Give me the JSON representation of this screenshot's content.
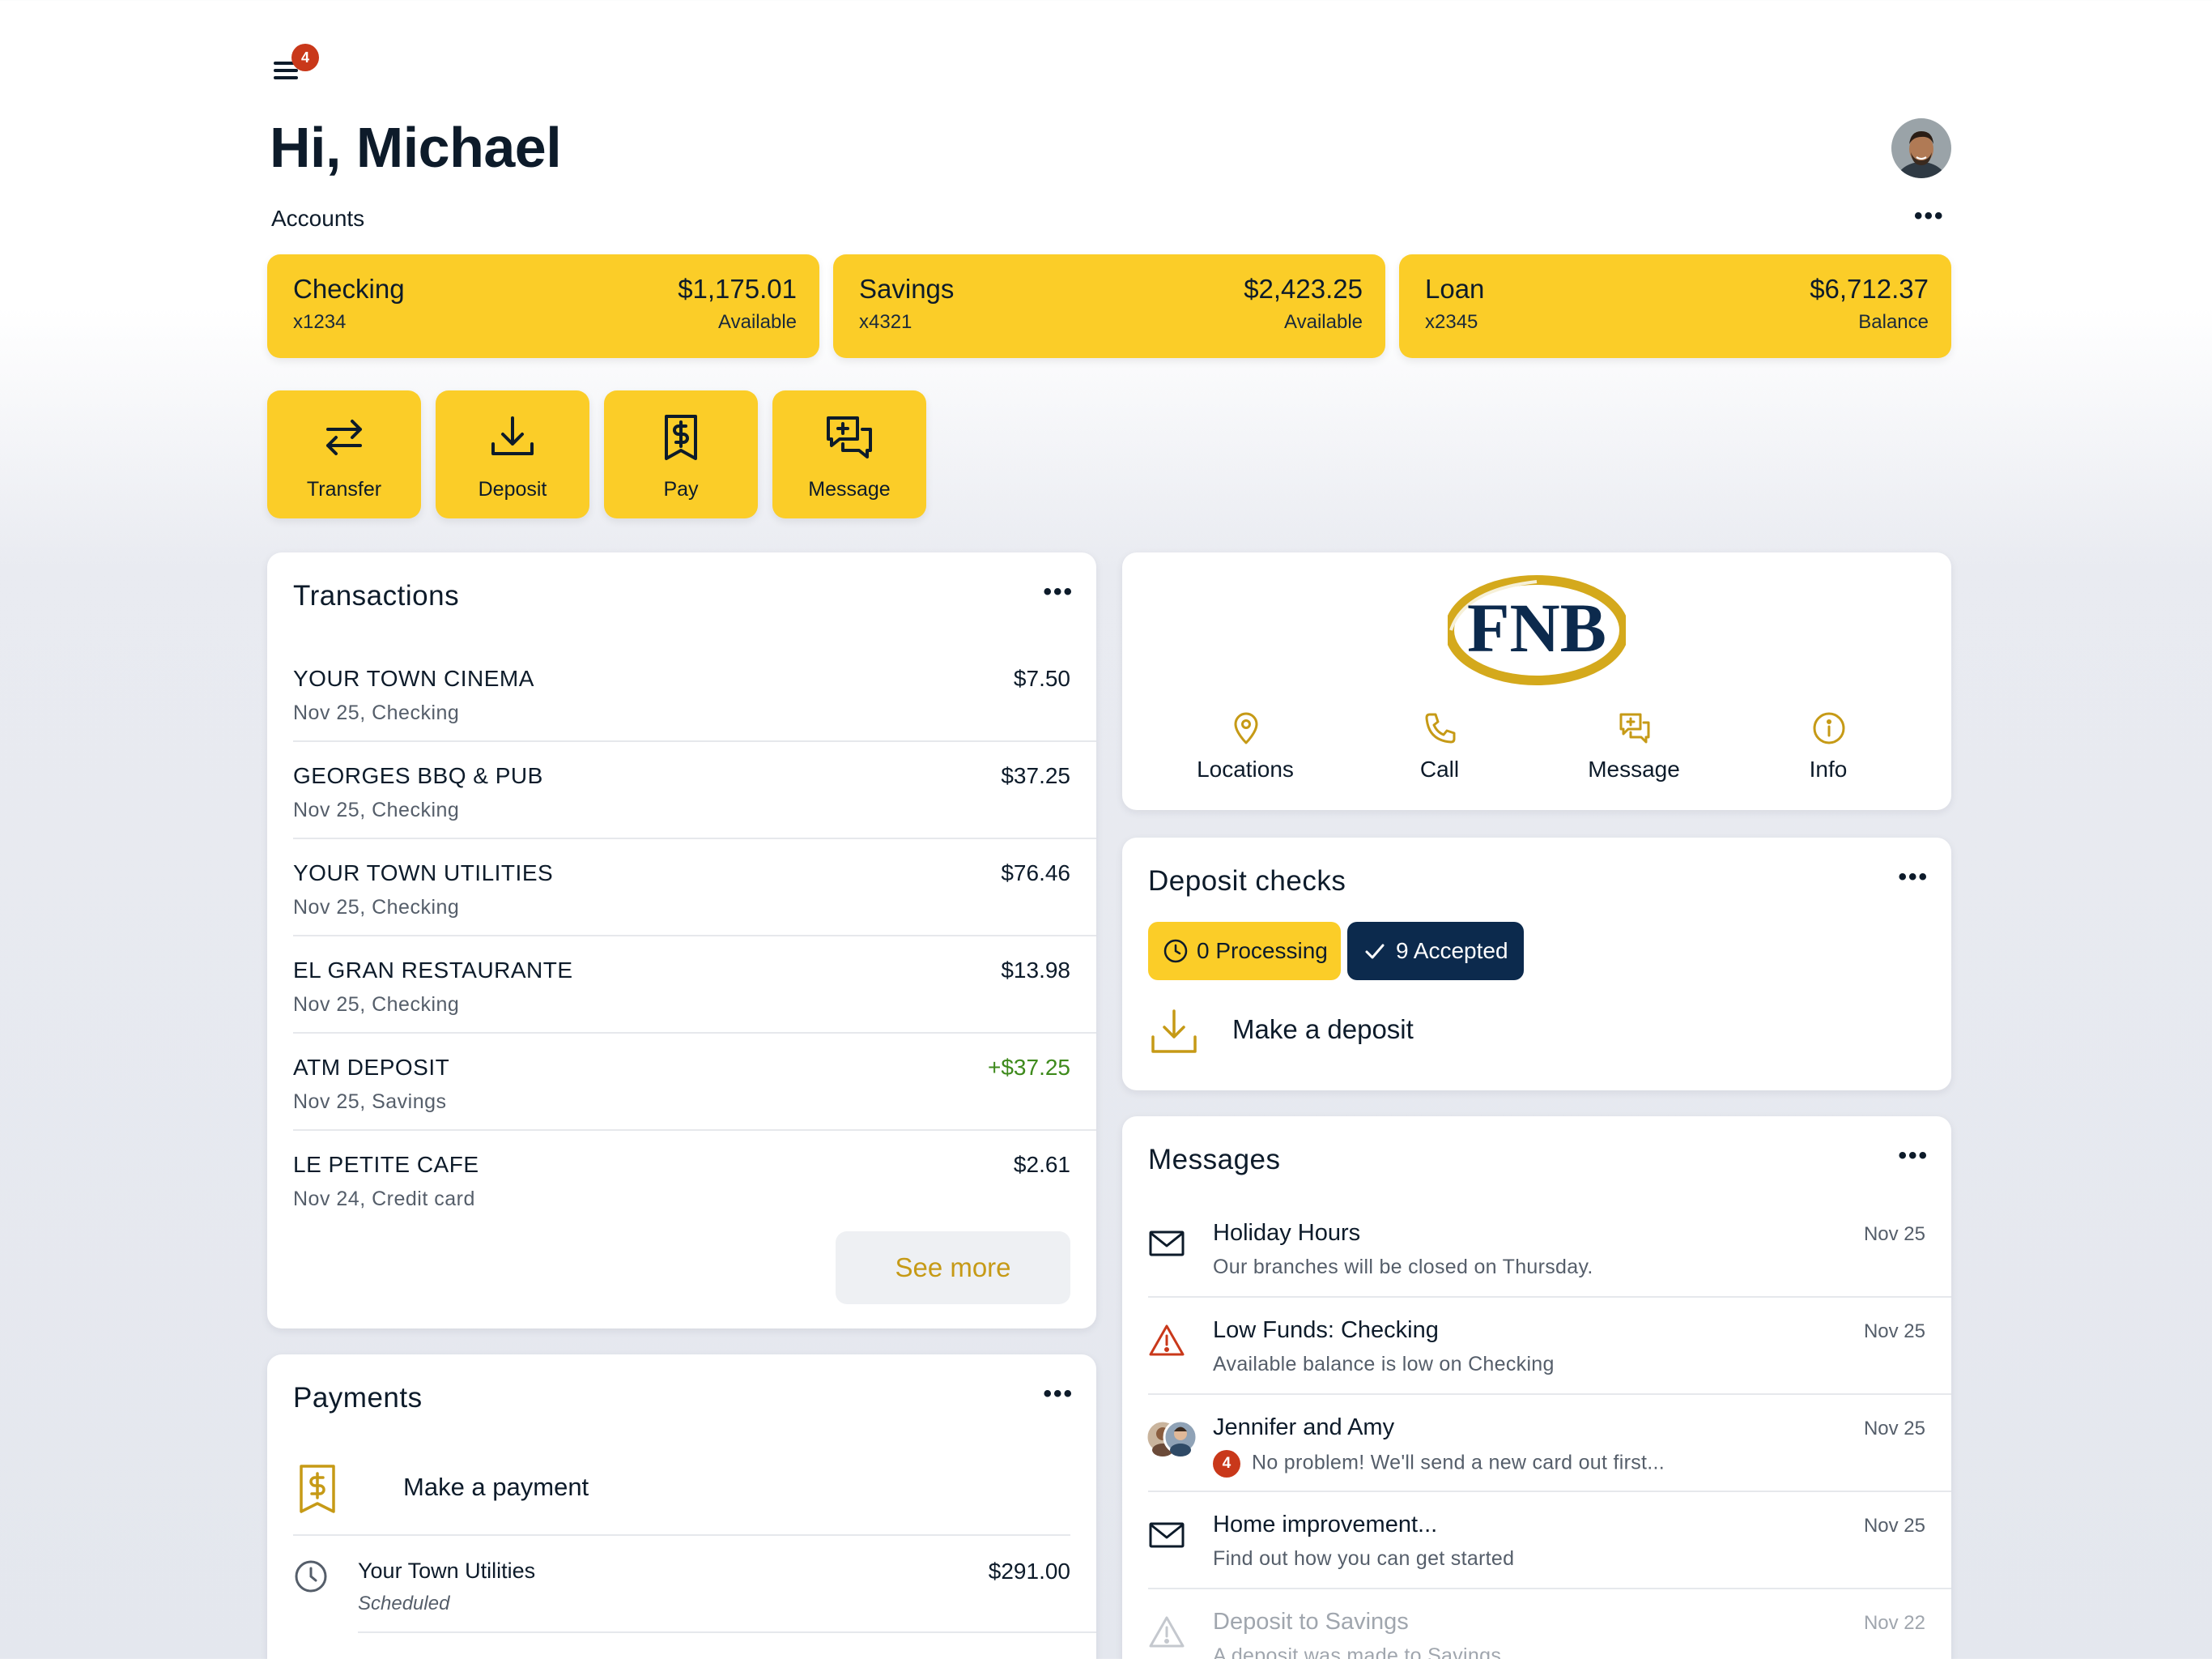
{
  "header": {
    "menu_badge_count": "4",
    "greeting": "Hi, Michael",
    "accounts_label": "Accounts"
  },
  "accounts": [
    {
      "name": "Checking",
      "number": "x1234",
      "amount": "$1,175.01",
      "sub": "Available"
    },
    {
      "name": "Savings",
      "number": "x4321",
      "amount": "$2,423.25",
      "sub": "Available"
    },
    {
      "name": "Loan",
      "number": "x2345",
      "amount": "$6,712.37",
      "sub": "Balance"
    }
  ],
  "quick_actions": [
    {
      "label": "Transfer",
      "icon": "transfer-icon"
    },
    {
      "label": "Deposit",
      "icon": "deposit-icon"
    },
    {
      "label": "Pay",
      "icon": "pay-bill-icon"
    },
    {
      "label": "Message",
      "icon": "message-icon"
    }
  ],
  "transactions": {
    "title": "Transactions",
    "items": [
      {
        "name": "YOUR TOWN CINEMA",
        "detail": "Nov 25, Checking",
        "amount": "$7.50"
      },
      {
        "name": "GEORGES BBQ & PUB",
        "detail": "Nov 25, Checking",
        "amount": "$37.25"
      },
      {
        "name": "YOUR TOWN UTILITIES",
        "detail": "Nov 25, Checking",
        "amount": "$76.46"
      },
      {
        "name": "EL GRAN RESTAURANTE",
        "detail": "Nov 25, Checking",
        "amount": "$13.98"
      },
      {
        "name": "ATM DEPOSIT",
        "detail": "Nov 25, Savings",
        "amount": "+$37.25"
      },
      {
        "name": "LE PETITE CAFE",
        "detail": "Nov 24, Credit card",
        "amount": "$2.61"
      }
    ],
    "see_more": "See more"
  },
  "payments": {
    "title": "Payments",
    "make_payment": "Make a payment",
    "items": [
      {
        "name": "Your Town Utilities",
        "status": "Scheduled",
        "amount": "$291.00"
      }
    ]
  },
  "bank": {
    "logo_text": "FNB",
    "links": [
      {
        "label": "Locations",
        "icon": "location-pin-icon"
      },
      {
        "label": "Call",
        "icon": "phone-icon"
      },
      {
        "label": "Message",
        "icon": "message-icon"
      },
      {
        "label": "Info",
        "icon": "info-icon"
      }
    ]
  },
  "deposit_checks": {
    "title": "Deposit checks",
    "processing": "0 Processing",
    "accepted": "9 Accepted",
    "make_deposit": "Make a deposit"
  },
  "messages": {
    "title": "Messages",
    "items": [
      {
        "title": "Holiday Hours",
        "snippet": "Our branches will be closed on Thursday.",
        "date": "Nov 25",
        "icon": "envelope-icon"
      },
      {
        "title": "Low Funds: Checking",
        "snippet": "Available balance is low on Checking",
        "date": "Nov 25",
        "icon": "warning-icon"
      },
      {
        "title": "Jennifer and Amy",
        "snippet": "No problem! We'll send a new card out first...",
        "date": "Nov 25",
        "icon": "avatar-pair",
        "badge": "4"
      },
      {
        "title": "Home improvement...",
        "snippet": "Find out how you can get started",
        "date": "Nov 25",
        "icon": "envelope-icon"
      },
      {
        "title": "Deposit to Savings",
        "snippet": "A deposit was made to Savings",
        "date": "Nov 22",
        "icon": "warning-icon"
      }
    ]
  },
  "colors": {
    "accent_yellow": "#fbcd28",
    "navy": "#0c2a4d",
    "gold_text": "#c69a16",
    "positive_green": "#3e8a1c",
    "alert_red": "#c9381a"
  }
}
